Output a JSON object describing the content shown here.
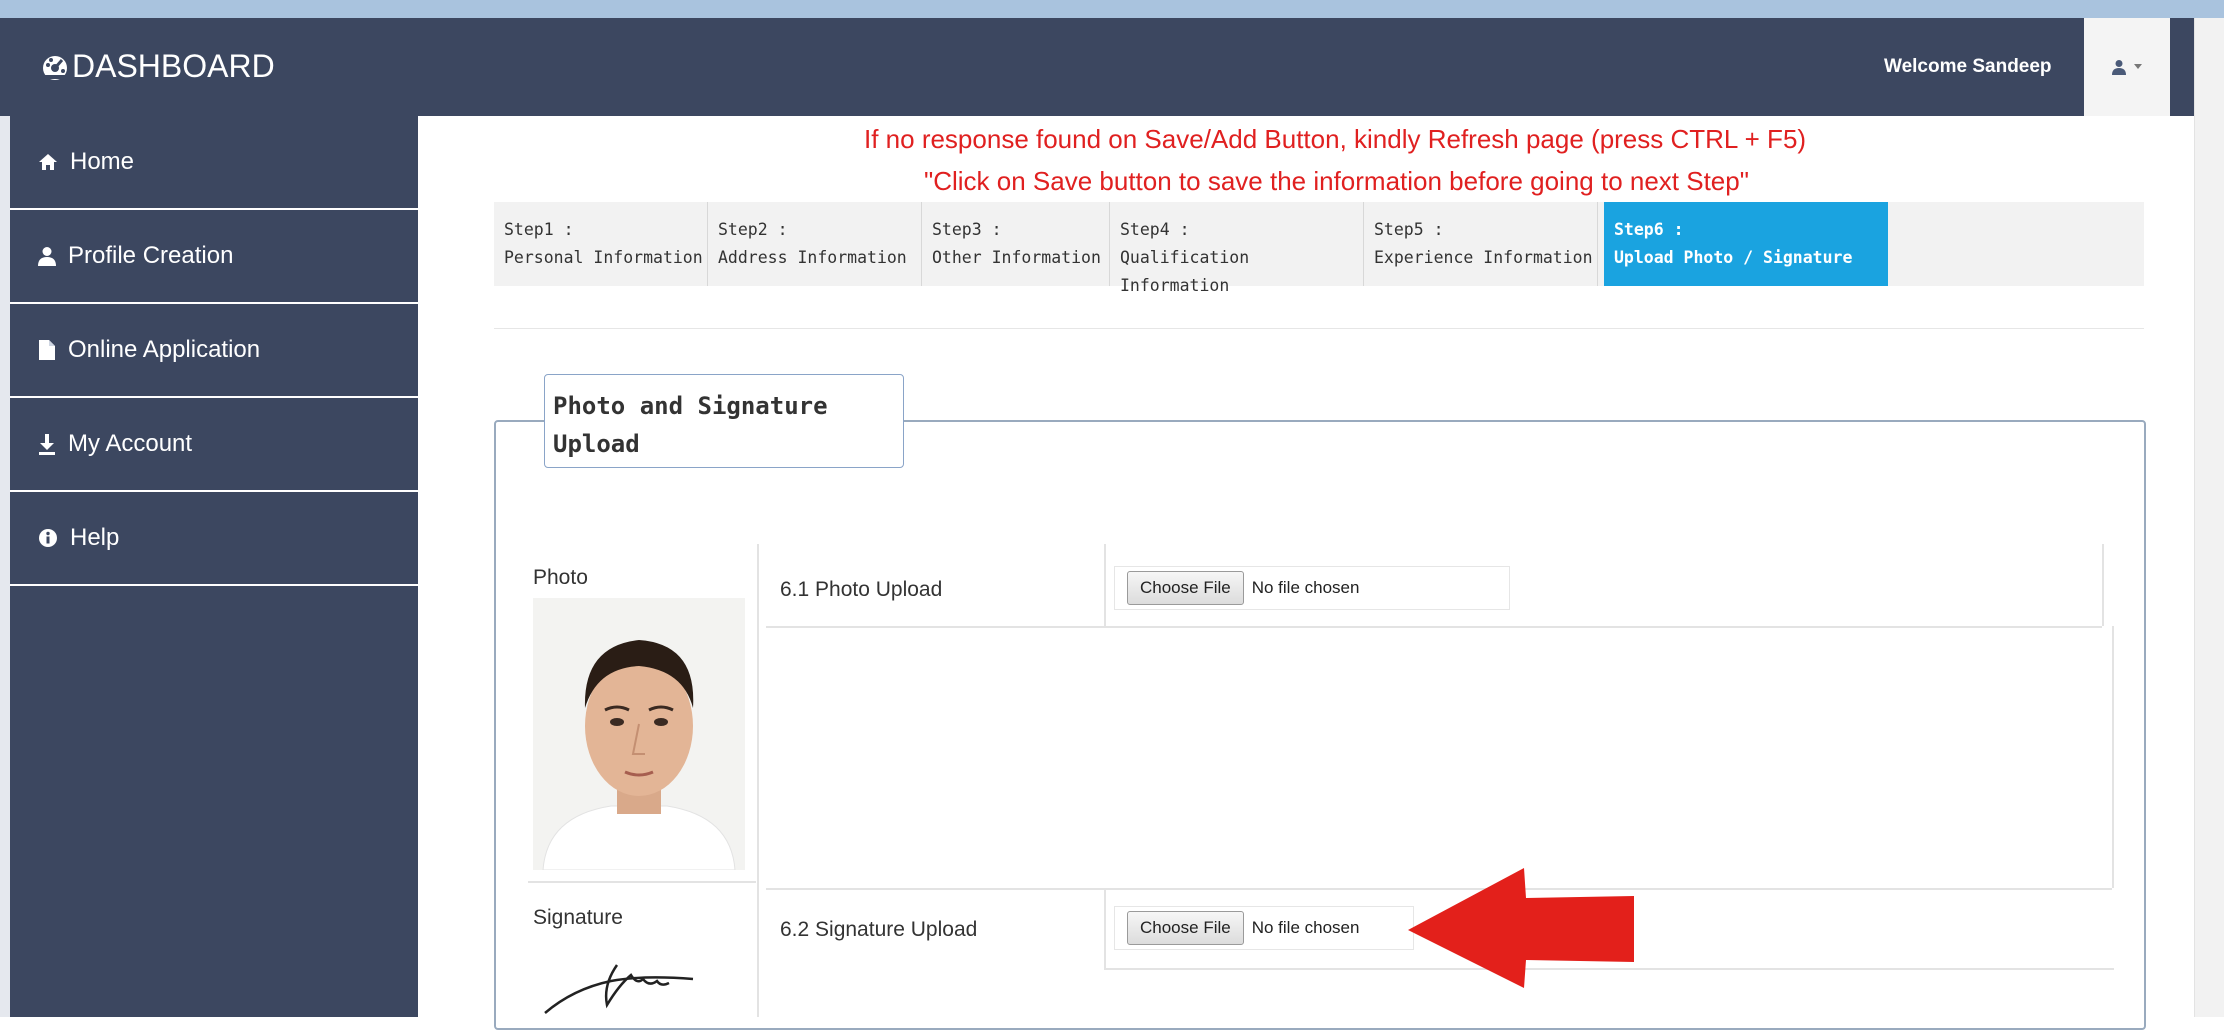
{
  "brand": {
    "label": "DASHBOARD",
    "icon": "dashboard-icon"
  },
  "header": {
    "welcome": "Welcome Sandeep",
    "user_icon": "user-icon",
    "dropdown_icon": "caret-down-icon"
  },
  "sidebar": {
    "items": [
      {
        "label": "Home",
        "icon": "home-icon"
      },
      {
        "label": "Profile Creation",
        "icon": "user-icon"
      },
      {
        "label": "Online Application",
        "icon": "file-icon"
      },
      {
        "label": "My Account",
        "icon": "download-icon"
      },
      {
        "label": "Help",
        "icon": "info-icon"
      }
    ]
  },
  "notices": {
    "line1": "If no response found on Save/Add Button, kindly Refresh page (press CTRL + F5)",
    "line2": "\"Click on Save button to save the information before going to next Step\""
  },
  "steps": [
    {
      "num": "Step1 :",
      "name": "Personal Information"
    },
    {
      "num": "Step2 :",
      "name": "Address Information"
    },
    {
      "num": "Step3 :",
      "name": "Other Information"
    },
    {
      "num": "Step4 :",
      "name": "Qualification Information"
    },
    {
      "num": "Step5 :",
      "name": "Experience Information"
    },
    {
      "num": "Step6 :",
      "name": "Upload Photo / Signature"
    }
  ],
  "active_step": 6,
  "section": {
    "title_line1": "Photo and Signature",
    "title_line2": "Upload"
  },
  "photo": {
    "label": "Photo",
    "field_label": "6.1 Photo Upload",
    "button": "Choose File",
    "status": "No file chosen"
  },
  "signature": {
    "label": "Signature",
    "field_label": "6.2 Signature Upload",
    "button": "Choose File",
    "status": "No file chosen"
  },
  "colors": {
    "navbar": "#3c4760",
    "active_step": "#1aa3e0",
    "notice": "#e02020",
    "arrow": "#e3201b"
  }
}
